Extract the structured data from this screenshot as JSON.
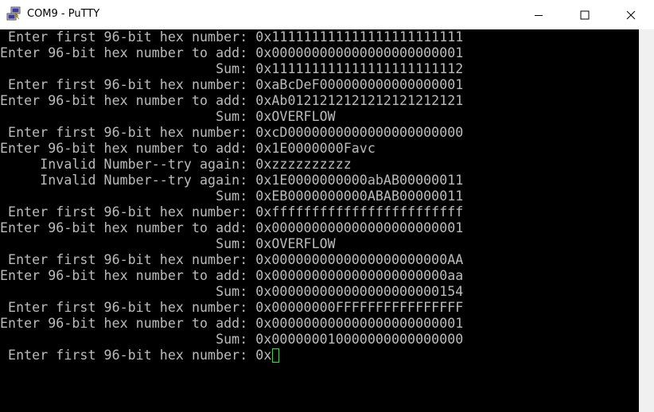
{
  "window": {
    "title": "COM9 - PuTTY",
    "icon": "putty-icon",
    "controls": {
      "minimize": "minimize-icon",
      "maximize": "maximize-icon",
      "close": "close-icon"
    }
  },
  "terminal": {
    "background": "#000000",
    "foreground": "#bbbbbb",
    "cursor_color": "#00ff00",
    "lines": [
      " Enter first 96-bit hex number: 0x111111111111111111111111",
      "Enter 96-bit hex number to add: 0x000000000000000000000001",
      "                           Sum: 0x111111111111111111111112",
      " Enter first 96-bit hex number: 0xaBcDeF000000000000000001",
      "Enter 96-bit hex number to add: 0xAb0121212121212121212121",
      "                           Sum: 0xOVERFLOW",
      " Enter first 96-bit hex number: 0xcD0000000000000000000000",
      "Enter 96-bit hex number to add: 0x1E0000000Favc",
      "     Invalid Number--try again: 0xzzzzzzzzzz",
      "     Invalid Number--try again: 0x1E0000000000abAB00000011",
      "                           Sum: 0xEB0000000000ABAB00000011",
      " Enter first 96-bit hex number: 0xffffffffffffffffffffffff",
      "Enter 96-bit hex number to add: 0x000000000000000000000001",
      "                           Sum: 0xOVERFLOW",
      " Enter first 96-bit hex number: 0x0000000000000000000000AA",
      "Enter 96-bit hex number to add: 0x0000000000000000000000aa",
      "                           Sum: 0x000000000000000000000154",
      " Enter first 96-bit hex number: 0x00000000FFFFFFFFFFFFFFFF",
      "Enter 96-bit hex number to add: 0x000000000000000000000001",
      "                           Sum: 0x000000010000000000000000"
    ],
    "prompt_line": " Enter first 96-bit hex number: 0x"
  }
}
